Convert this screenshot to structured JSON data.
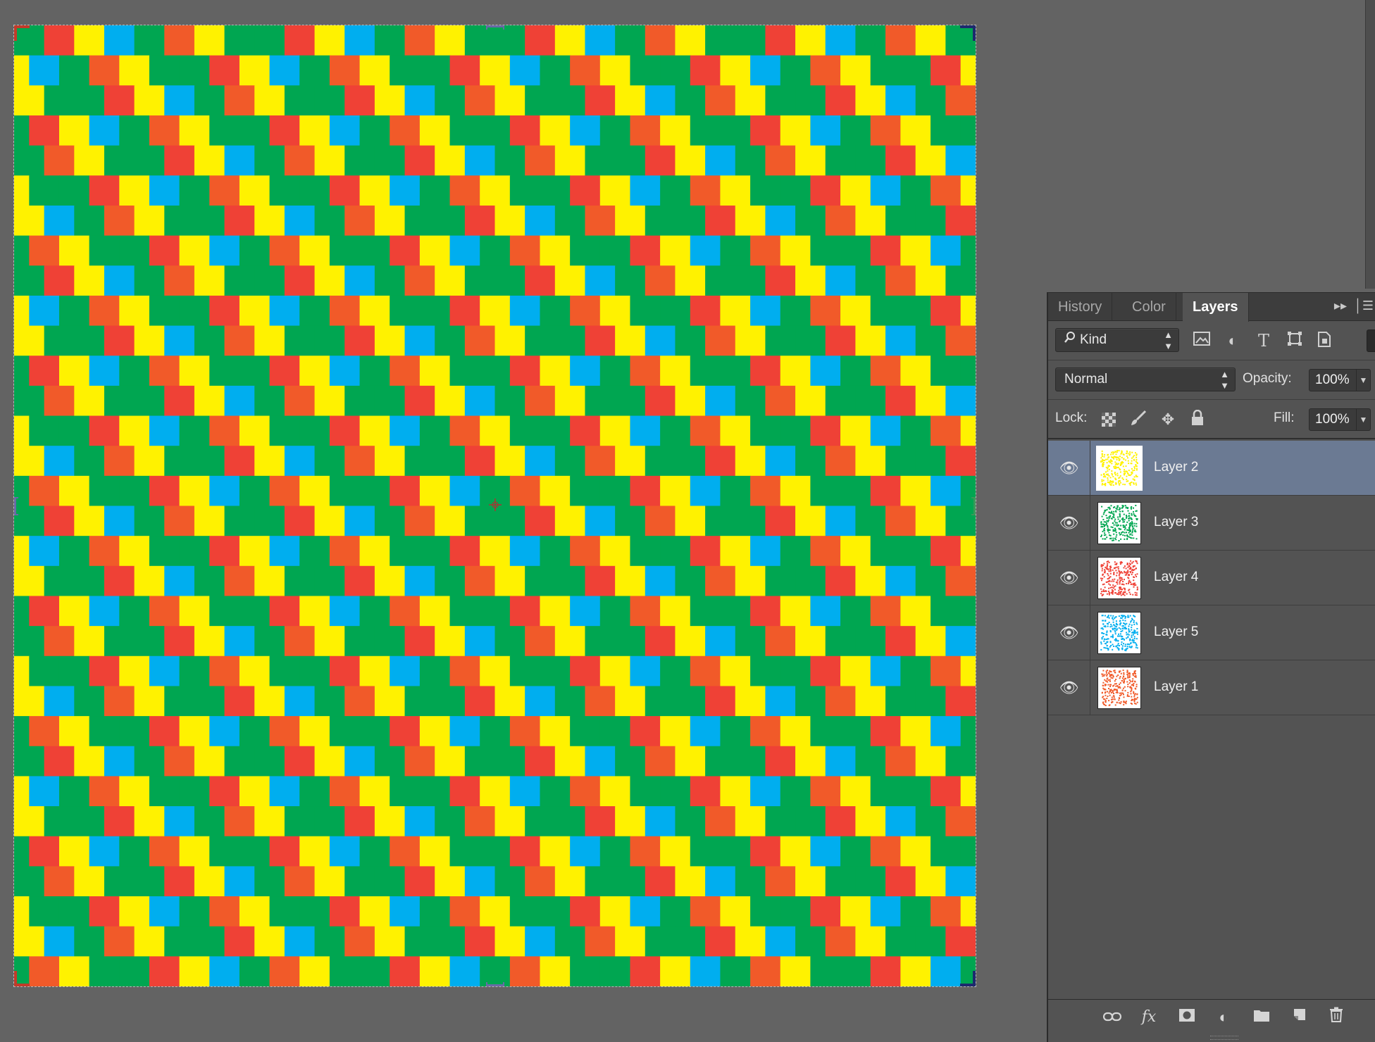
{
  "canvas": {
    "palette": {
      "red": "#ef4136",
      "orange": "#f15a29",
      "yellow": "#fff200",
      "blue": "#00aeef",
      "green": "#00a651"
    },
    "columns": 32,
    "rows": 32
  },
  "panel": {
    "tabs": [
      {
        "label": "History"
      },
      {
        "label": "Color"
      },
      {
        "label": "Layers",
        "active": true
      }
    ],
    "collapse_icon": "double-chevron-right-icon",
    "menu_icon": "panel-menu-icon",
    "filter": {
      "kind_label": "Kind",
      "icons": [
        "pixel-layer-filter-icon",
        "adjustment-layer-filter-icon",
        "type-layer-filter-icon",
        "shape-layer-filter-icon",
        "smart-object-filter-icon"
      ]
    },
    "blend_mode": "Normal",
    "opacity_label": "Opacity:",
    "opacity_value": "100%",
    "lock_label": "Lock:",
    "fill_label": "Fill:",
    "fill_value": "100%",
    "layers": [
      {
        "name": "Layer 2",
        "visible": true,
        "selected": true,
        "thumb_color": "#fff200"
      },
      {
        "name": "Layer 3",
        "visible": true,
        "selected": false,
        "thumb_color": "#00a651"
      },
      {
        "name": "Layer 4",
        "visible": true,
        "selected": false,
        "thumb_color": "#ef4136"
      },
      {
        "name": "Layer 5",
        "visible": true,
        "selected": false,
        "thumb_color": "#00aeef"
      },
      {
        "name": "Layer 1",
        "visible": true,
        "selected": false,
        "thumb_color": "#f15a29"
      }
    ],
    "footer_icons": [
      "link-layers-icon",
      "fx-icon",
      "layer-mask-icon",
      "adjustment-icon",
      "group-folder-icon",
      "new-layer-icon",
      "trash-icon"
    ]
  }
}
